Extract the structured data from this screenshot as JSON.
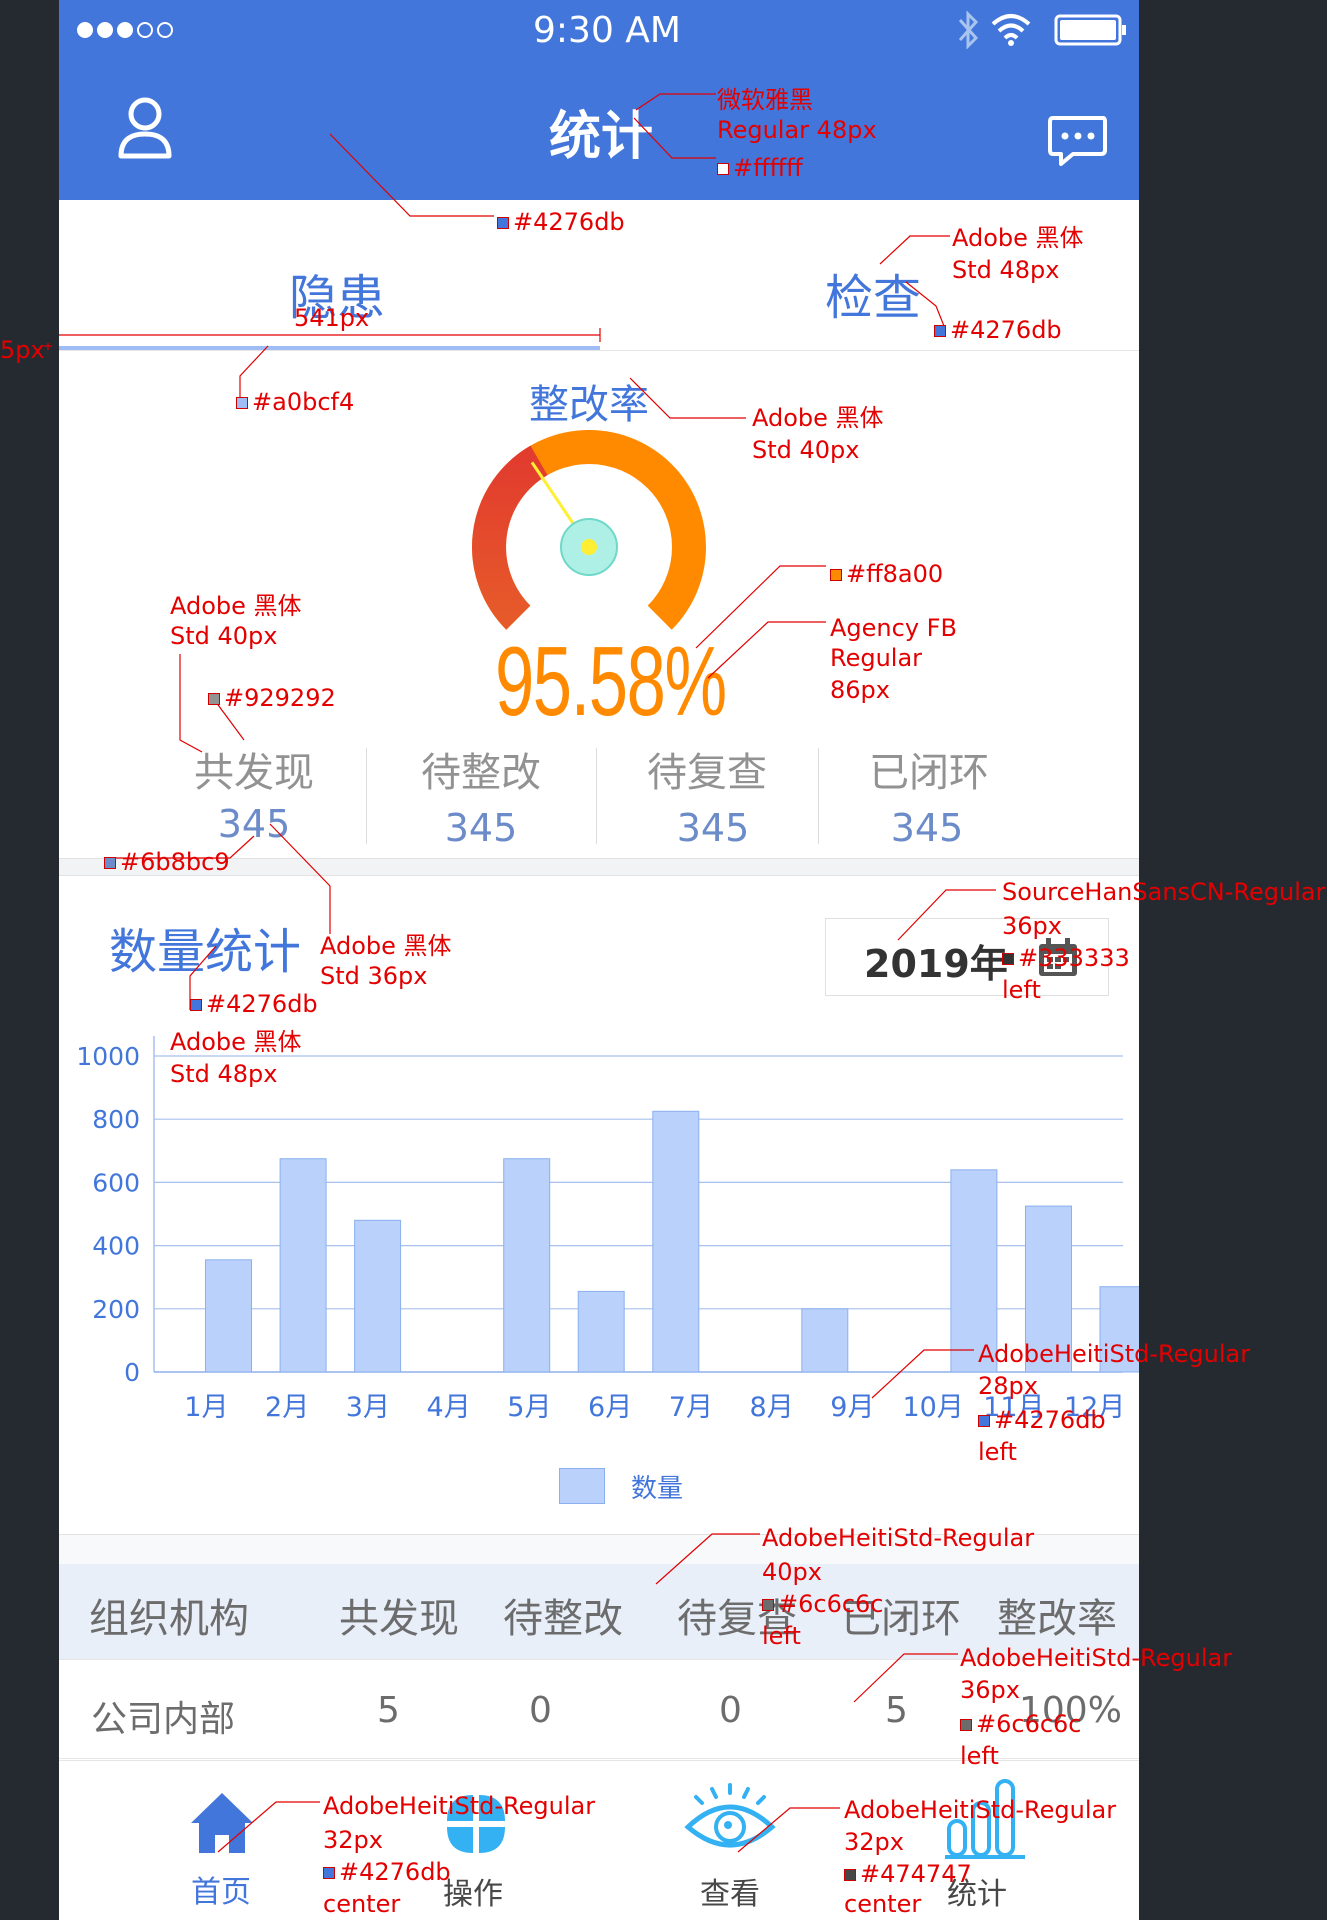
{
  "status_bar": {
    "time": "9:30 AM",
    "signal_filled": 3,
    "signal_total": 5
  },
  "header": {
    "title": "统计"
  },
  "tabs": {
    "left": "隐患",
    "right": "检查",
    "indicator_width_label": "541px"
  },
  "gauge": {
    "title": "整改率",
    "value_text": "95.58%",
    "value": 95.58
  },
  "stats": [
    {
      "label": "共发现",
      "value": "345"
    },
    {
      "label": "待整改",
      "value": "345"
    },
    {
      "label": "待复查",
      "value": "345"
    },
    {
      "label": "已闭环",
      "value": "345"
    }
  ],
  "quantity_section": {
    "title": "数量统计",
    "year": "2019年"
  },
  "chart_data": {
    "type": "bar",
    "categories": [
      "1月",
      "2月",
      "3月",
      "4月",
      "5月",
      "6月",
      "7月",
      "8月",
      "9月",
      "10月",
      "11月",
      "12月"
    ],
    "series": [
      {
        "name": "数量",
        "values": [
          355,
          675,
          480,
          675,
          255,
          825,
          200,
          640,
          525,
          270
        ]
      }
    ],
    "values": [
      355,
      675,
      480,
      675,
      255,
      825,
      200,
      640,
      525,
      270
    ],
    "yticks": [
      "1000",
      "800",
      "600",
      "400",
      "200",
      "0"
    ],
    "ylim": [
      0,
      1000
    ],
    "grid": true,
    "legend": "bottom-center"
  },
  "table": {
    "headers": [
      "组织机构",
      "共发现",
      "待整改",
      "待复查",
      "已闭环",
      "整改率"
    ],
    "rows": [
      [
        "公司内部",
        "5",
        "0",
        "0",
        "5",
        "100%"
      ]
    ]
  },
  "bottom_nav": [
    {
      "label": "首页",
      "icon": "home-icon"
    },
    {
      "label": "操作",
      "icon": "grid-icon"
    },
    {
      "label": "查看",
      "icon": "eye-icon"
    },
    {
      "label": "统计",
      "icon": "stats-icon"
    }
  ],
  "colors": {
    "primary": "#4276db",
    "indicator": "#a0bcf4",
    "gauge": "#ff8a00",
    "stat_label": "#929292",
    "stat_value": "#6b8bc9",
    "year_text": "#333333",
    "table_text": "#6c6c6c",
    "nav_inactive": "#474747",
    "white": "#ffffff"
  },
  "annotations": {
    "a1": "微软雅黑",
    "a2": "Regular 48px",
    "a3": "#ffffff",
    "a4": "#4276db",
    "a5": "Adobe 黑体",
    "a6": "Std 48px",
    "a7": "#4276db",
    "a8": "5px",
    "a9": "#a0bcf4",
    "a10": "Adobe 黑体",
    "a11": "Std 40px",
    "a12": "#ff8a00",
    "a13": "Agency FB",
    "a14": "Regular",
    "a15": "86px",
    "a16": "Adobe 黑体",
    "a17": "Std  40px",
    "a18": "#929292",
    "a19": "#6b8bc9",
    "a20": "Adobe 黑体",
    "a21": "Std 36px",
    "a22": "#4276db",
    "a23": "Adobe 黑体",
    "a24": "Std  48px",
    "a25": "SourceHanSansCN-Regular",
    "a26": "36px",
    "a27": "#333333",
    "a28": "left",
    "a29": "AdobeHeitiStd-Regular",
    "a30": "28px",
    "a31": "#4276db",
    "a32": "left",
    "a33": "AdobeHeitiStd-Regular",
    "a34": "40px",
    "a35": "#6c6c6c",
    "a36": "left",
    "a37": "AdobeHeitiStd-Regular",
    "a38": "36px",
    "a39": "#6c6c6c",
    "a40": "left",
    "a41": "AdobeHeitiStd-Regular",
    "a42": "32px",
    "a43": "#4276db",
    "a44": "center",
    "a45": "AdobeHeitiStd-Regular",
    "a46": "32px",
    "a47": "#474747",
    "a48": "center"
  }
}
